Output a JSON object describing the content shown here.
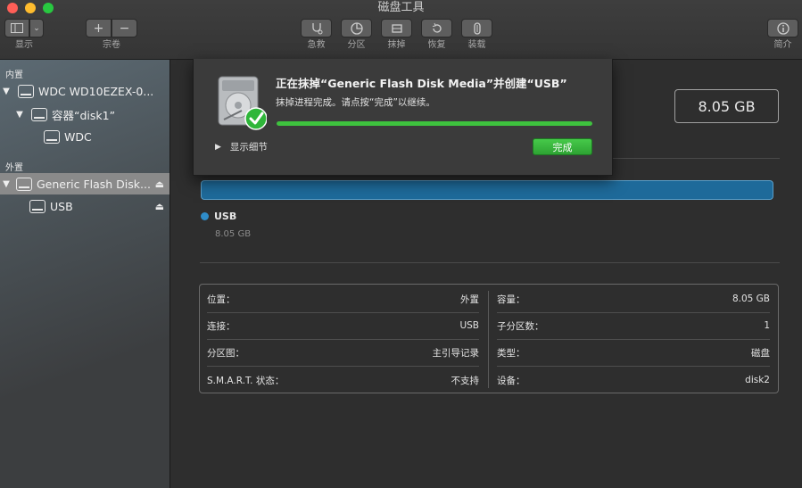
{
  "window": {
    "title": "磁盘工具"
  },
  "toolbar": {
    "view_label": "显示",
    "volume_label": "宗卷",
    "first_aid_label": "急救",
    "partition_label": "分区",
    "erase_label": "抹掉",
    "restore_label": "恢复",
    "mount_label": "装载",
    "info_label": "简介",
    "add_symbol": "+",
    "remove_symbol": "−"
  },
  "sidebar": {
    "internal_header": "内置",
    "external_header": "外置",
    "items": [
      {
        "label": "WDC WD10EZEX-0..."
      },
      {
        "label": "容器“disk1”"
      },
      {
        "label": "WDC"
      },
      {
        "label": "Generic Flash Disk..."
      },
      {
        "label": "USB"
      }
    ]
  },
  "main": {
    "capacity_box": "8.05 GB",
    "volume": {
      "name": "USB",
      "size": "8.05 GB"
    },
    "info": {
      "left": [
        {
          "label": "位置：",
          "value": "外置"
        },
        {
          "label": "连接：",
          "value": "USB"
        },
        {
          "label": "分区图：",
          "value": "主引导记录"
        },
        {
          "label": "S.M.A.R.T. 状态：",
          "value": "不支持"
        }
      ],
      "right": [
        {
          "label": "容量：",
          "value": "8.05 GB"
        },
        {
          "label": "子分区数：",
          "value": "1"
        },
        {
          "label": "类型：",
          "value": "磁盘"
        },
        {
          "label": "设备：",
          "value": "disk2"
        }
      ]
    }
  },
  "dialog": {
    "title": "正在抹掉“Generic Flash Disk Media”并创建“USB”",
    "message": "抹掉进程完成。请点按“完成”以继续。",
    "details_label": "显示细节",
    "done_label": "完成",
    "progress": 1.0
  },
  "colors": {
    "accent_green": "#3ec23e",
    "partition_blue": "#1e6a9a",
    "close": "#ff5f57",
    "minimize": "#febc2e",
    "zoom": "#28c840"
  }
}
